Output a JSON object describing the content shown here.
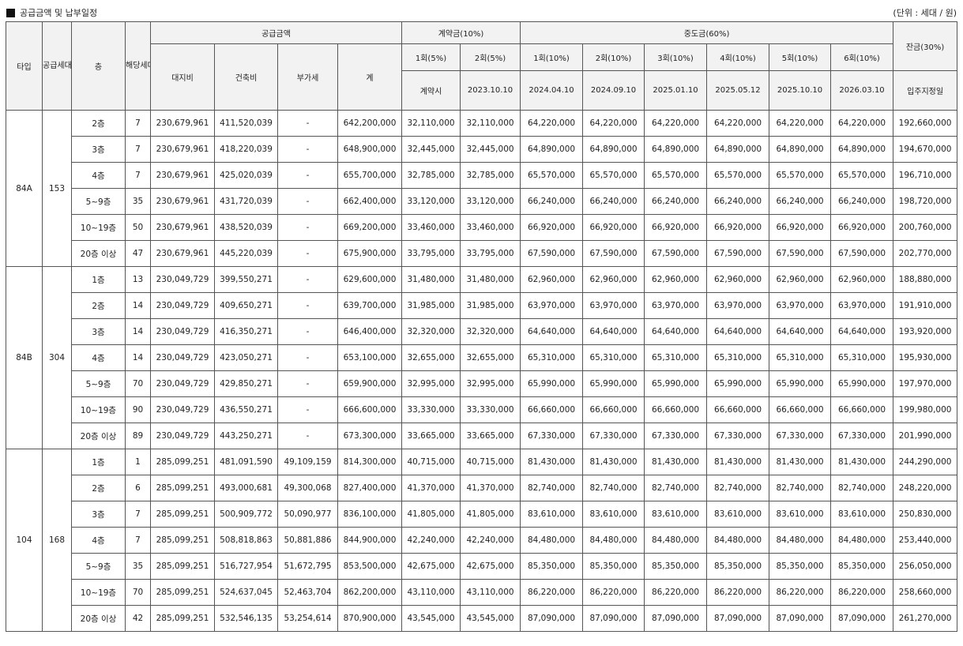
{
  "title": "공급금액 및 납부일정",
  "unit": "(단위 : 세대 / 원)",
  "headers": {
    "type": "타입",
    "supply_units": "공급세대수",
    "floor": "층",
    "applicable_units": "해당세대수",
    "supply_amount": "공급금액",
    "land": "대지비",
    "building": "건축비",
    "vat": "부가세",
    "total": "계",
    "contract": "계약금(10%)",
    "interim": "중도금(60%)",
    "balance": "잔금(30%)",
    "installments": [
      "1회(5%)",
      "2회(5%)",
      "1회(10%)",
      "2회(10%)",
      "3회(10%)",
      "4회(10%)",
      "5회(10%)",
      "6회(10%)"
    ],
    "dates": [
      "계약시",
      "2023.10.10",
      "2024.04.10",
      "2024.09.10",
      "2025.01.10",
      "2025.05.12",
      "2025.10.10",
      "2026.03.10"
    ],
    "balance_date": "입주지정일"
  },
  "groups": [
    {
      "type": "84A",
      "units": "153",
      "rows": [
        {
          "floor": "2층",
          "count": "7",
          "land": "230,679,961",
          "building": "411,520,039",
          "vat": "-",
          "total": "642,200,000",
          "c1": "32,110,000",
          "c2": "32,110,000",
          "m": "64,220,000",
          "balance": "192,660,000"
        },
        {
          "floor": "3층",
          "count": "7",
          "land": "230,679,961",
          "building": "418,220,039",
          "vat": "-",
          "total": "648,900,000",
          "c1": "32,445,000",
          "c2": "32,445,000",
          "m": "64,890,000",
          "balance": "194,670,000"
        },
        {
          "floor": "4층",
          "count": "7",
          "land": "230,679,961",
          "building": "425,020,039",
          "vat": "-",
          "total": "655,700,000",
          "c1": "32,785,000",
          "c2": "32,785,000",
          "m": "65,570,000",
          "balance": "196,710,000"
        },
        {
          "floor": "5~9층",
          "count": "35",
          "land": "230,679,961",
          "building": "431,720,039",
          "vat": "-",
          "total": "662,400,000",
          "c1": "33,120,000",
          "c2": "33,120,000",
          "m": "66,240,000",
          "balance": "198,720,000"
        },
        {
          "floor": "10~19층",
          "count": "50",
          "land": "230,679,961",
          "building": "438,520,039",
          "vat": "-",
          "total": "669,200,000",
          "c1": "33,460,000",
          "c2": "33,460,000",
          "m": "66,920,000",
          "balance": "200,760,000"
        },
        {
          "floor": "20층 이상",
          "count": "47",
          "land": "230,679,961",
          "building": "445,220,039",
          "vat": "-",
          "total": "675,900,000",
          "c1": "33,795,000",
          "c2": "33,795,000",
          "m": "67,590,000",
          "balance": "202,770,000"
        }
      ]
    },
    {
      "type": "84B",
      "units": "304",
      "rows": [
        {
          "floor": "1층",
          "count": "13",
          "land": "230,049,729",
          "building": "399,550,271",
          "vat": "-",
          "total": "629,600,000",
          "c1": "31,480,000",
          "c2": "31,480,000",
          "m": "62,960,000",
          "balance": "188,880,000"
        },
        {
          "floor": "2층",
          "count": "14",
          "land": "230,049,729",
          "building": "409,650,271",
          "vat": "-",
          "total": "639,700,000",
          "c1": "31,985,000",
          "c2": "31,985,000",
          "m": "63,970,000",
          "balance": "191,910,000"
        },
        {
          "floor": "3층",
          "count": "14",
          "land": "230,049,729",
          "building": "416,350,271",
          "vat": "-",
          "total": "646,400,000",
          "c1": "32,320,000",
          "c2": "32,320,000",
          "m": "64,640,000",
          "balance": "193,920,000"
        },
        {
          "floor": "4층",
          "count": "14",
          "land": "230,049,729",
          "building": "423,050,271",
          "vat": "-",
          "total": "653,100,000",
          "c1": "32,655,000",
          "c2": "32,655,000",
          "m": "65,310,000",
          "balance": "195,930,000"
        },
        {
          "floor": "5~9층",
          "count": "70",
          "land": "230,049,729",
          "building": "429,850,271",
          "vat": "-",
          "total": "659,900,000",
          "c1": "32,995,000",
          "c2": "32,995,000",
          "m": "65,990,000",
          "balance": "197,970,000"
        },
        {
          "floor": "10~19층",
          "count": "90",
          "land": "230,049,729",
          "building": "436,550,271",
          "vat": "-",
          "total": "666,600,000",
          "c1": "33,330,000",
          "c2": "33,330,000",
          "m": "66,660,000",
          "balance": "199,980,000"
        },
        {
          "floor": "20층 이상",
          "count": "89",
          "land": "230,049,729",
          "building": "443,250,271",
          "vat": "-",
          "total": "673,300,000",
          "c1": "33,665,000",
          "c2": "33,665,000",
          "m": "67,330,000",
          "balance": "201,990,000"
        }
      ]
    },
    {
      "type": "104",
      "units": "168",
      "rows": [
        {
          "floor": "1층",
          "count": "1",
          "land": "285,099,251",
          "building": "481,091,590",
          "vat": "49,109,159",
          "total": "814,300,000",
          "c1": "40,715,000",
          "c2": "40,715,000",
          "m": "81,430,000",
          "balance": "244,290,000"
        },
        {
          "floor": "2층",
          "count": "6",
          "land": "285,099,251",
          "building": "493,000,681",
          "vat": "49,300,068",
          "total": "827,400,000",
          "c1": "41,370,000",
          "c2": "41,370,000",
          "m": "82,740,000",
          "balance": "248,220,000"
        },
        {
          "floor": "3층",
          "count": "7",
          "land": "285,099,251",
          "building": "500,909,772",
          "vat": "50,090,977",
          "total": "836,100,000",
          "c1": "41,805,000",
          "c2": "41,805,000",
          "m": "83,610,000",
          "balance": "250,830,000"
        },
        {
          "floor": "4층",
          "count": "7",
          "land": "285,099,251",
          "building": "508,818,863",
          "vat": "50,881,886",
          "total": "844,900,000",
          "c1": "42,240,000",
          "c2": "42,240,000",
          "m": "84,480,000",
          "balance": "253,440,000"
        },
        {
          "floor": "5~9층",
          "count": "35",
          "land": "285,099,251",
          "building": "516,727,954",
          "vat": "51,672,795",
          "total": "853,500,000",
          "c1": "42,675,000",
          "c2": "42,675,000",
          "m": "85,350,000",
          "balance": "256,050,000"
        },
        {
          "floor": "10~19층",
          "count": "70",
          "land": "285,099,251",
          "building": "524,637,045",
          "vat": "52,463,704",
          "total": "862,200,000",
          "c1": "43,110,000",
          "c2": "43,110,000",
          "m": "86,220,000",
          "balance": "258,660,000"
        },
        {
          "floor": "20층 이상",
          "count": "42",
          "land": "285,099,251",
          "building": "532,546,135",
          "vat": "53,254,614",
          "total": "870,900,000",
          "c1": "43,545,000",
          "c2": "43,545,000",
          "m": "87,090,000",
          "balance": "261,270,000"
        }
      ]
    }
  ]
}
